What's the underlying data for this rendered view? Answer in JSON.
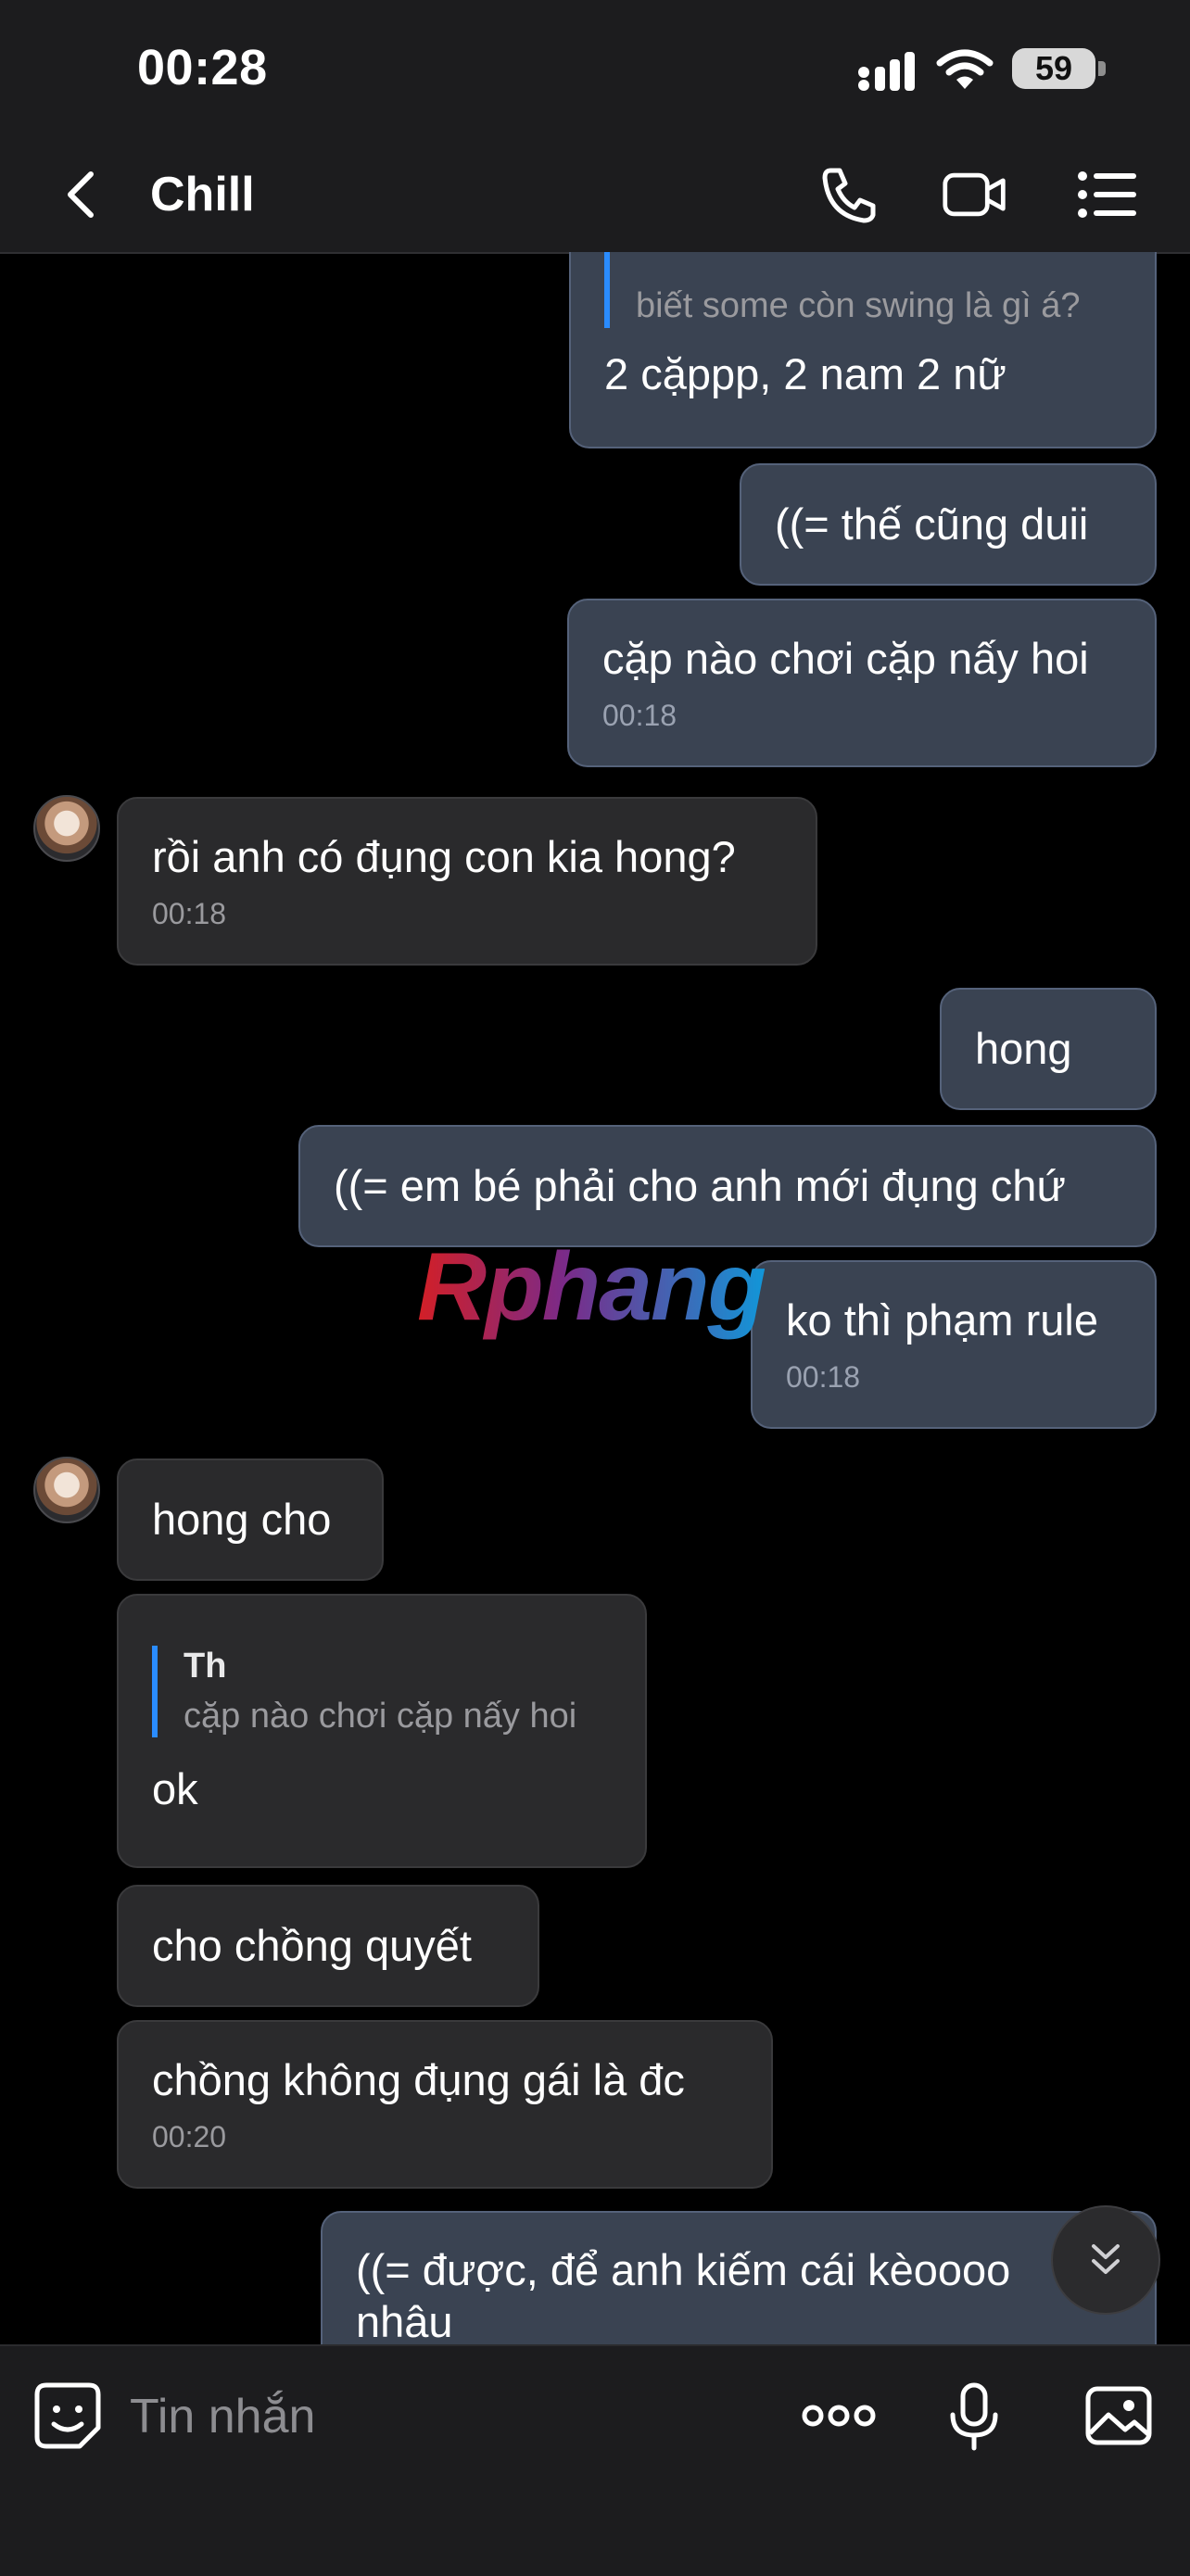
{
  "status": {
    "time": "00:28",
    "battery": "59"
  },
  "nav": {
    "title": "Chill",
    "icons": [
      "back-chevron-icon",
      "phone-icon",
      "video-icon",
      "menu-list-icon"
    ]
  },
  "messages": [
    {
      "id": "m1",
      "side": "out",
      "quote_text": "biết some còn swing là gì á?",
      "text": "2 cặppp, 2 nam 2 nữ"
    },
    {
      "id": "m2",
      "side": "out",
      "text": "((= thế cũng duii"
    },
    {
      "id": "m3",
      "side": "out",
      "text": "cặp nào chơi cặp nấy hoi",
      "time": "00:18"
    },
    {
      "id": "m4",
      "side": "in",
      "text": "rồi anh có đụng con kia hong?",
      "time": "00:18"
    },
    {
      "id": "m5",
      "side": "out",
      "text": "hong"
    },
    {
      "id": "m6",
      "side": "out",
      "text": "((= em bé phải cho anh mới đụng chứ"
    },
    {
      "id": "m7",
      "side": "out",
      "text": "ko thì phạm rule",
      "time": "00:18"
    },
    {
      "id": "m8",
      "side": "in",
      "text": "hong cho"
    },
    {
      "id": "m9",
      "side": "in",
      "quote_name": "Th",
      "quote_text": "cặp nào chơi cặp nấy hoi",
      "text": "ok"
    },
    {
      "id": "m10",
      "side": "in",
      "text": "cho chồng quyết"
    },
    {
      "id": "m11",
      "side": "in",
      "text": "chồng không đụng gái là đc",
      "time": "00:20"
    },
    {
      "id": "m12",
      "side": "out",
      "text": "((= được, để anh kiếm cái kèoooo nhâu"
    }
  ],
  "watermark": "Rphang",
  "composer": {
    "placeholder": "Tin nhắn",
    "icons": [
      "sticker-icon",
      "more-icon",
      "microphone-icon",
      "image-icon"
    ]
  }
}
